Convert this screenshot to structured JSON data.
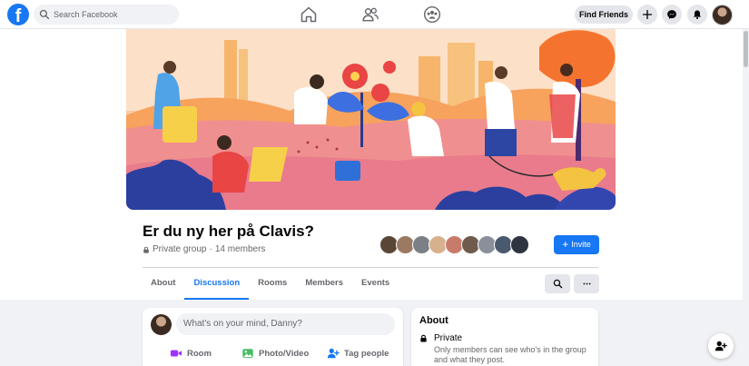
{
  "nav": {
    "logo": "f",
    "search_placeholder": "Search Facebook",
    "icons": [
      "home-icon",
      "friends-icon",
      "groups-icon"
    ],
    "find_friends_label": "Find Friends",
    "right_icons": [
      "plus-icon",
      "messenger-icon",
      "notifications-icon"
    ]
  },
  "group": {
    "title": "Er du ny her på Clavis?",
    "privacy": "Private group",
    "separator": "·",
    "member_count": "14 members",
    "invite_label": "Invite",
    "invite_icon": "+"
  },
  "tabs": [
    {
      "label": "About",
      "active": false
    },
    {
      "label": "Discussion",
      "active": true
    },
    {
      "label": "Rooms",
      "active": false
    },
    {
      "label": "Members",
      "active": false
    },
    {
      "label": "Events",
      "active": false
    }
  ],
  "composer": {
    "placeholder": "What's on your mind, Danny?",
    "actions": [
      {
        "label": "Room",
        "icon": "video-room-icon"
      },
      {
        "label": "Photo/Video",
        "icon": "photo-icon"
      },
      {
        "label": "Tag people",
        "icon": "tag-people-icon"
      }
    ]
  },
  "about": {
    "heading": "About",
    "privacy_title": "Private",
    "privacy_desc": "Only members can see who's in the group and what they post."
  },
  "colors": {
    "brand": "#1877f2",
    "background": "#f0f2f5",
    "text_secondary": "#65676b"
  }
}
